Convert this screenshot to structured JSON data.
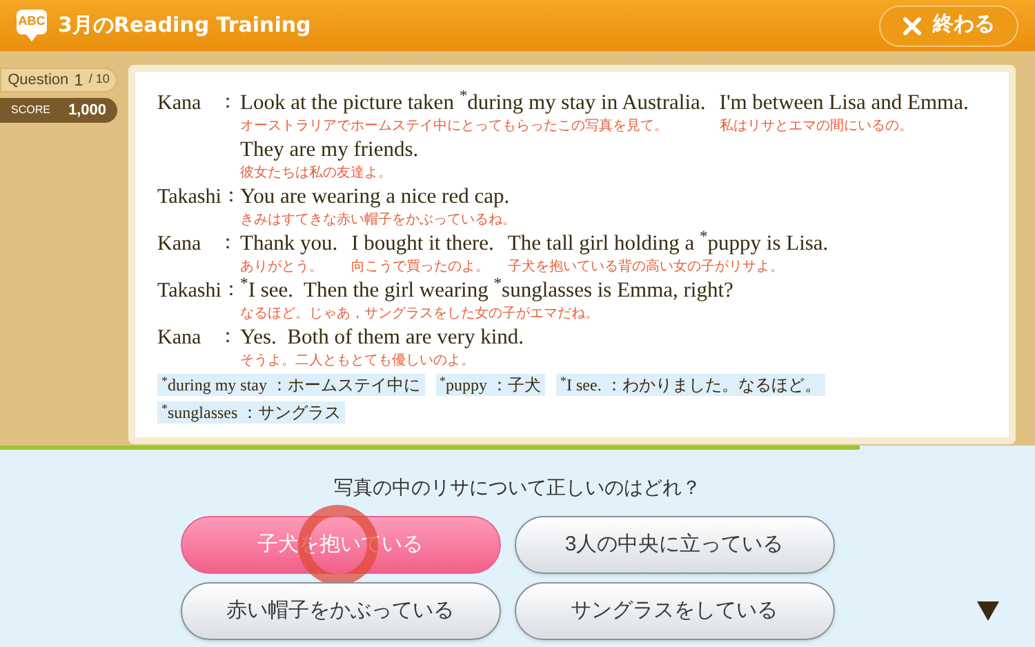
{
  "header": {
    "logo": "ABC",
    "title": "3月のReading Training",
    "close_button": "終わる"
  },
  "sidebar": {
    "question_label": "Question",
    "question_current": "1",
    "question_total": "/ 10",
    "score_label": "SCORE",
    "score": "1,000"
  },
  "dialogue": [
    {
      "speaker": "Kana",
      "separator": "：",
      "rows": [
        [
          {
            "en": "Look at the picture taken $^{*}$during my stay in Australia.",
            "ja": "オーストラリアでホームステイ中にとってもらったこの写真を見て。"
          },
          {
            "en": "I'm between Lisa and Emma.",
            "ja": "私はリサとエマの間にいるの。"
          }
        ],
        [
          {
            "en": "They are my friends.",
            "ja": "彼女たちは私の友達よ。"
          }
        ]
      ]
    },
    {
      "speaker": "Takashi",
      "separator": "：",
      "rows": [
        [
          {
            "en": "You are wearing a nice red cap.",
            "ja": "きみはすてきな赤い帽子をかぶっているね。"
          }
        ]
      ]
    },
    {
      "speaker": "Kana",
      "separator": "：",
      "rows": [
        [
          {
            "en": "Thank you.",
            "ja": "ありがとう。"
          },
          {
            "en": "I bought it there.",
            "ja": "向こうで買ったのよ。"
          },
          {
            "en": "The tall girl holding a $^{*}$puppy is Lisa.",
            "ja": "子犬を抱いている背の高い女の子がリサよ。"
          }
        ]
      ]
    },
    {
      "speaker": "Takashi",
      "separator": "：",
      "rows": [
        [
          {
            "en": "$^{*}$I see.  Then the girl wearing $^{*}$sunglasses is Emma, right?",
            "ja": "なるほど。じゃあ，サングラスをした女の子がエマだね。"
          }
        ]
      ]
    },
    {
      "speaker": "Kana",
      "separator": "：",
      "rows": [
        [
          {
            "en": "Yes.  Both of them are very kind.",
            "ja": "そうよ。二人ともとても優しいのよ。"
          }
        ]
      ]
    }
  ],
  "glossary": [
    "$^{*}$during my stay ：ホームステイ中に",
    "$^{*}$puppy ：子犬",
    "$^{*}$I see. ：わかりました。なるほど。",
    "$^{*}$sunglasses ：サングラス"
  ],
  "progress": {
    "level": 0.83
  },
  "question": "写真の中のリサについて正しいのはどれ？",
  "answers": [
    {
      "label": "子犬を抱いている",
      "selected": true
    },
    {
      "label": "3人の中央に立っている",
      "selected": false
    },
    {
      "label": "赤い帽子をかぶっている",
      "selected": false
    },
    {
      "label": "サングラスをしている",
      "selected": false
    }
  ]
}
